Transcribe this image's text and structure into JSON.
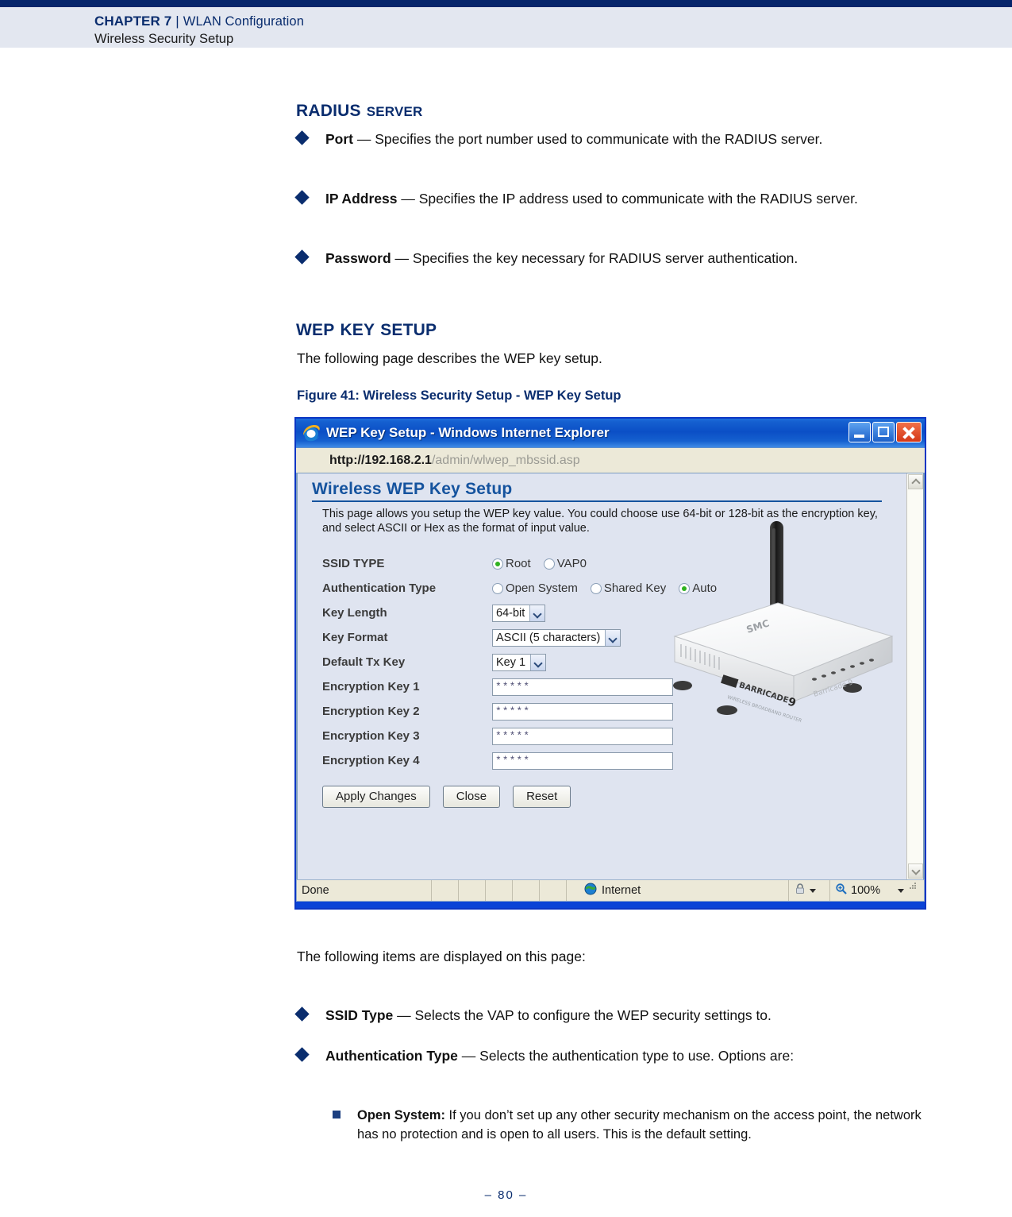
{
  "header": {
    "chapter": "CHAPTER 7",
    "chapter_caps": "C",
    "separator": "|",
    "chapter_title": "WLAN Configuration",
    "subtitle": "Wireless Security Setup"
  },
  "footer": {
    "page_number": "–  80  –"
  },
  "sections": {
    "radius": {
      "heading_main": "RADIUS",
      "heading_rest": "SERVER",
      "bullets": [
        {
          "term": "Port",
          "dash": " — ",
          "text": "Specifies the port number used to communicate with the RADIUS server."
        },
        {
          "term": "IP Address",
          "dash": " — ",
          "text": "Specifies the IP address used to communicate with the RADIUS server."
        },
        {
          "term": "Password",
          "dash": " — ",
          "text": "Specifies the key necessary for RADIUS server authentication."
        }
      ]
    },
    "wep": {
      "heading_main": "WEP",
      "heading_key": "KEY",
      "heading_setup": "SETUP",
      "intro": "The following page describes the WEP key setup.",
      "figure_caption": "Figure 41:  Wireless Security Setup - WEP Key Setup",
      "items_intro": "The following items are displayed on this page:",
      "bullets": [
        {
          "term": "SSID Type",
          "dash": " — ",
          "text": "Selects the VAP to configure the WEP security settings to."
        },
        {
          "term": "Authentication Type",
          "dash": " — ",
          "text": "Selects the authentication type to use. Options are:"
        }
      ],
      "sub_bullets": [
        {
          "term": "Open System:",
          "text": " If you don’t set up any other security mechanism on the access point, the network has no protection and is open to all users. This is the default setting."
        }
      ]
    }
  },
  "figure": {
    "browser": {
      "window_title": "WEP Key Setup - Windows Internet Explorer",
      "address_host": "http://192.168.2.1",
      "address_path": "/admin/wlwep_mbssid.asp",
      "minimize_label": "Minimize",
      "maximize_label": "Maximize",
      "close_label": "Close",
      "status": {
        "done": "Done",
        "zone": "Internet",
        "zoom": "100%"
      }
    },
    "page": {
      "title": "Wireless WEP Key Setup",
      "description": "This page allows you setup the WEP key value. You could choose use 64-bit or 128-bit as the encryption key, and select ASCII or Hex as the format of input value.",
      "rows": [
        {
          "label": "SSID TYPE",
          "type": "radio",
          "options": [
            {
              "label": "Root",
              "selected": true
            },
            {
              "label": "VAP0",
              "selected": false
            }
          ]
        },
        {
          "label": "Authentication Type",
          "type": "radio",
          "options": [
            {
              "label": "Open System",
              "selected": false
            },
            {
              "label": "Shared Key",
              "selected": false
            },
            {
              "label": "Auto",
              "selected": true
            }
          ]
        },
        {
          "label": "Key Length",
          "type": "select",
          "value": "64-bit"
        },
        {
          "label": "Key Format",
          "type": "select",
          "value": "ASCII (5 characters)"
        },
        {
          "label": "Default Tx Key",
          "type": "select",
          "value": "Key 1"
        },
        {
          "label": "Encryption Key 1",
          "type": "text",
          "value": "*****"
        },
        {
          "label": "Encryption Key 2",
          "type": "text",
          "value": "*****"
        },
        {
          "label": "Encryption Key 3",
          "type": "text",
          "value": "*****"
        },
        {
          "label": "Encryption Key 4",
          "type": "text",
          "value": "*****"
        }
      ],
      "buttons": [
        {
          "label": "Apply Changes"
        },
        {
          "label": "Close"
        },
        {
          "label": "Reset"
        }
      ],
      "router_brand": "SMC BARRICADE 9"
    }
  },
  "colors": {
    "navy_band": "#06256b",
    "header_bg": "#e3e7f0",
    "heading_blue": "#0a2d6e",
    "web_title_blue": "#15539e",
    "titlebar_blue": "#0b4fc6",
    "radio_green": "#2fb21f"
  }
}
